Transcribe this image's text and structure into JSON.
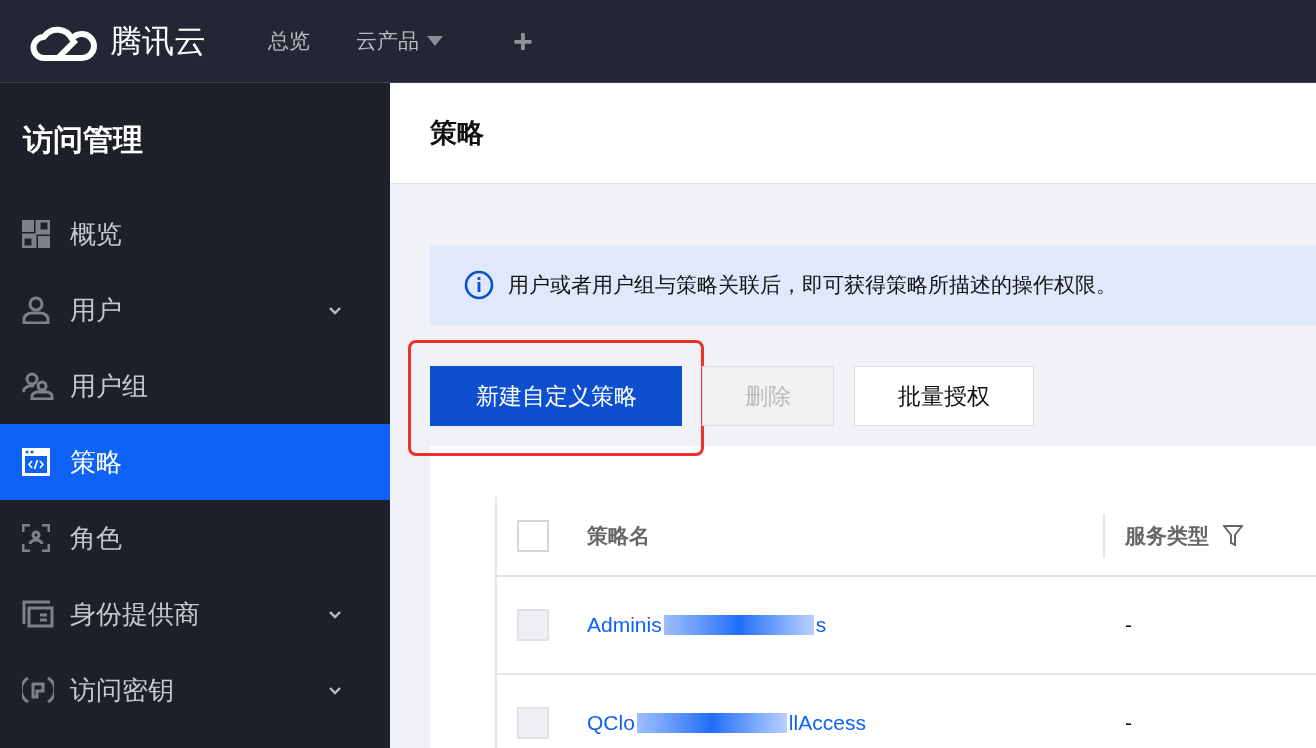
{
  "topbar": {
    "brand": "腾讯云",
    "nav": [
      {
        "label": "总览",
        "dropdown": false
      },
      {
        "label": "云产品",
        "dropdown": true
      }
    ],
    "add": "+"
  },
  "sidebar": {
    "title": "访问管理",
    "items": [
      {
        "label": "概览",
        "kind": "grid",
        "expandable": false,
        "selected": false
      },
      {
        "label": "用户",
        "kind": "user",
        "expandable": true,
        "selected": false
      },
      {
        "label": "用户组",
        "kind": "users",
        "expandable": false,
        "selected": false
      },
      {
        "label": "策略",
        "kind": "code",
        "expandable": false,
        "selected": true
      },
      {
        "label": "角色",
        "kind": "role",
        "expandable": false,
        "selected": false
      },
      {
        "label": "身份提供商",
        "kind": "idp",
        "expandable": true,
        "selected": false
      },
      {
        "label": "访问密钥",
        "kind": "key",
        "expandable": true,
        "selected": false
      }
    ]
  },
  "page": {
    "title": "策略",
    "notice": "用户或者用户组与策略关联后，即可获得策略所描述的操作权限。",
    "buttons": [
      {
        "label": "新建自定义策略",
        "kind": "primary",
        "disabled": false,
        "highlighted": true
      },
      {
        "label": "删除",
        "kind": "default",
        "disabled": true,
        "highlighted": false
      },
      {
        "label": "批量授权",
        "kind": "default",
        "disabled": false,
        "highlighted": false
      }
    ],
    "table": {
      "select_all_checked": false,
      "columns": [
        "策略名",
        "服务类型"
      ],
      "column_filter": [
        false,
        true
      ],
      "rows": [
        {
          "checked": false,
          "name": "Adminis",
          "name_tail": "s",
          "service_type": "-"
        },
        {
          "checked": false,
          "name": "QClo",
          "name_tail": "llAccess",
          "service_type": "-"
        }
      ]
    }
  }
}
